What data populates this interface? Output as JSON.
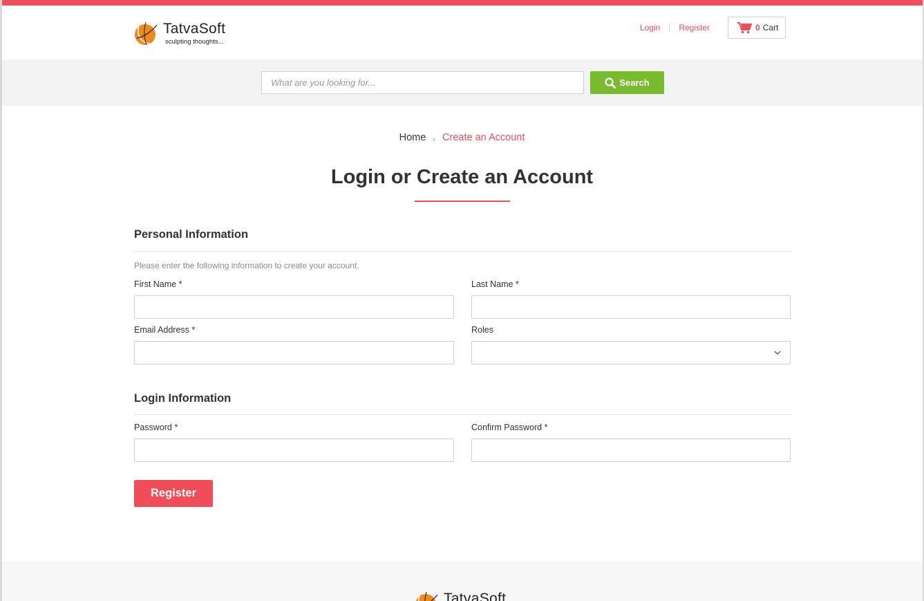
{
  "brand": {
    "name": "TatvaSoft",
    "tagline": "sculpting thoughts..."
  },
  "header": {
    "links": {
      "login": "Login",
      "register": "Register"
    },
    "cart": {
      "count": "0",
      "label": "Cart"
    }
  },
  "search": {
    "placeholder": "What are you looking for...",
    "button_label": "Search"
  },
  "breadcrumb": {
    "home": "Home",
    "separator": "›",
    "current": "Create an Account"
  },
  "page": {
    "title": "Login or Create an Account"
  },
  "personal_info": {
    "heading": "Personal Information",
    "helper": "Please enter the following information to create your account.",
    "first_name_label": "First Name *",
    "last_name_label": "Last Name *",
    "email_label": "Email Address *",
    "roles_label": "Roles",
    "first_name_value": "",
    "last_name_value": "",
    "email_value": "",
    "roles_value": ""
  },
  "login_info": {
    "heading": "Login Information",
    "password_label": "Password *",
    "confirm_password_label": "Confirm Password *",
    "password_value": "",
    "confirm_password_value": ""
  },
  "actions": {
    "register_label": "Register"
  },
  "colors": {
    "accent": "#f14d59",
    "search_button": "#78bc2e",
    "logo_orange": "#f08a1c"
  },
  "icons": {
    "search": "search-icon",
    "cart": "cart-icon",
    "dropdown": "chevron-down-icon",
    "logo": "tatvasoft-logo-icon"
  }
}
